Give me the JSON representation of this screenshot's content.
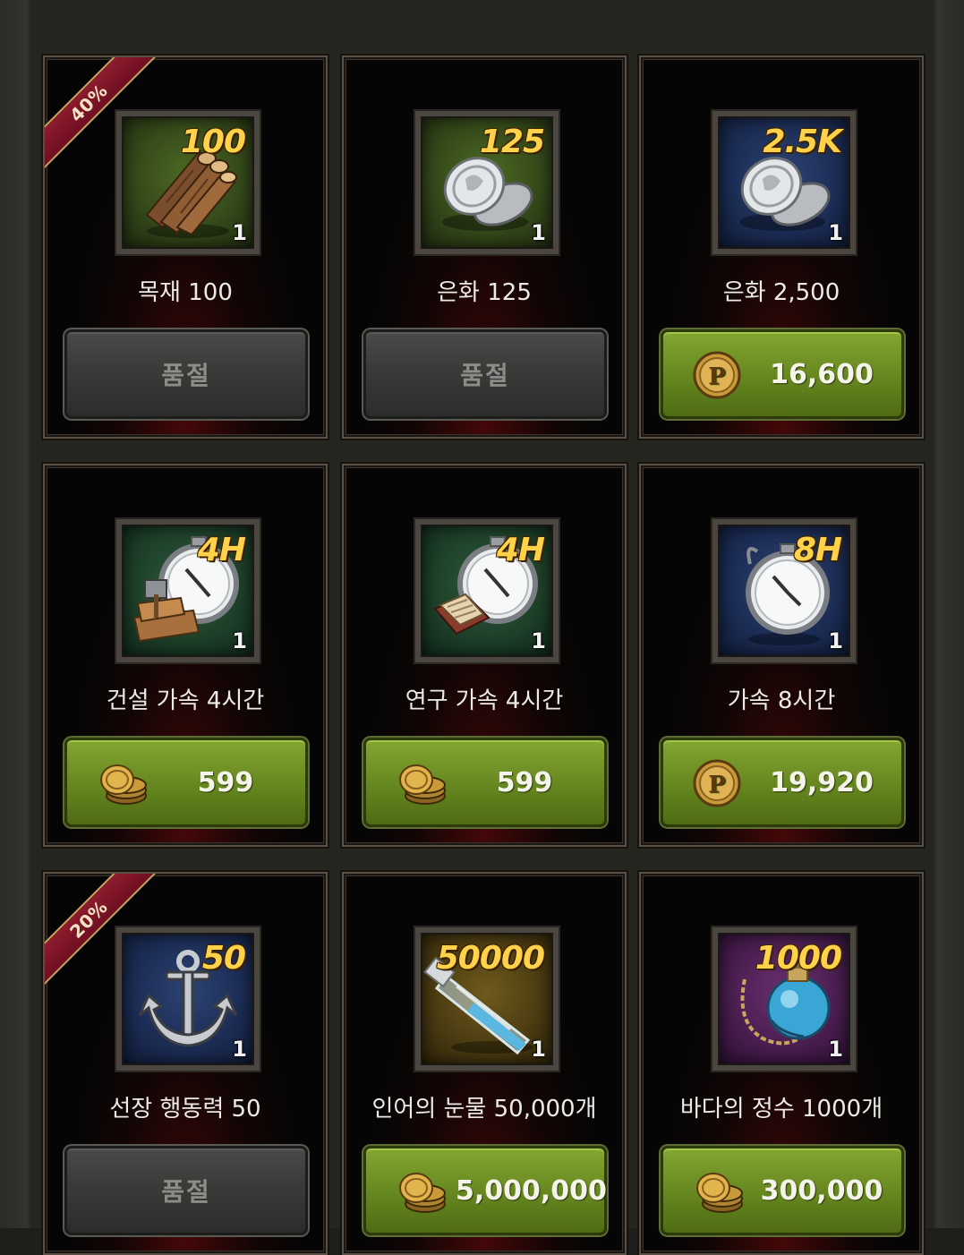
{
  "colors": {
    "accent_green": "#6a8c22",
    "sold_out_gray": "#3a3a38",
    "ribbon": "#8e1b2e",
    "amount_gold": "#ffd24a"
  },
  "cards": [
    {
      "name": "목재 100",
      "amount": "100",
      "qty": "1",
      "icon": "wood-logs-icon",
      "bg": "green",
      "ribbon": "40%",
      "state": "sold_out",
      "button_label": "품절",
      "currency": ""
    },
    {
      "name": "은화 125",
      "amount": "125",
      "qty": "1",
      "icon": "silver-coins-icon",
      "bg": "green",
      "ribbon": "",
      "state": "sold_out",
      "button_label": "품절",
      "currency": ""
    },
    {
      "name": "은화 2,500",
      "amount": "2.5K",
      "qty": "1",
      "icon": "silver-coins-icon",
      "bg": "blue",
      "ribbon": "",
      "state": "buy",
      "button_label": "16,600",
      "currency": "p-coin-icon"
    },
    {
      "name": "건설 가속 4시간",
      "amount": "4H",
      "qty": "1",
      "icon": "build-speedup-stopwatch-icon",
      "bg": "teal",
      "ribbon": "",
      "state": "buy",
      "button_label": "599",
      "currency": "gold-coins-icon"
    },
    {
      "name": "연구 가속 4시간",
      "amount": "4H",
      "qty": "1",
      "icon": "research-speedup-stopwatch-icon",
      "bg": "teal",
      "ribbon": "",
      "state": "buy",
      "button_label": "599",
      "currency": "gold-coins-icon"
    },
    {
      "name": "가속 8시간",
      "amount": "8H",
      "qty": "1",
      "icon": "stopwatch-icon",
      "bg": "blue",
      "ribbon": "",
      "state": "buy",
      "button_label": "19,920",
      "currency": "p-coin-icon"
    },
    {
      "name": "선장 행동력 50",
      "amount": "50",
      "qty": "1",
      "icon": "anchor-icon",
      "bg": "blue",
      "ribbon": "20%",
      "state": "sold_out",
      "button_label": "품절",
      "currency": ""
    },
    {
      "name": "인어의 눈물 50,000개",
      "amount": "50000",
      "qty": "1",
      "icon": "mermaid-tear-vial-icon",
      "bg": "gold",
      "ribbon": "",
      "state": "buy",
      "button_label": "5,000,000",
      "currency": "gold-coins-icon"
    },
    {
      "name": "바다의 정수 1000개",
      "amount": "1000",
      "qty": "1",
      "icon": "sea-essence-flask-icon",
      "bg": "purple",
      "ribbon": "",
      "state": "buy",
      "button_label": "300,000",
      "currency": "gold-coins-icon"
    }
  ]
}
